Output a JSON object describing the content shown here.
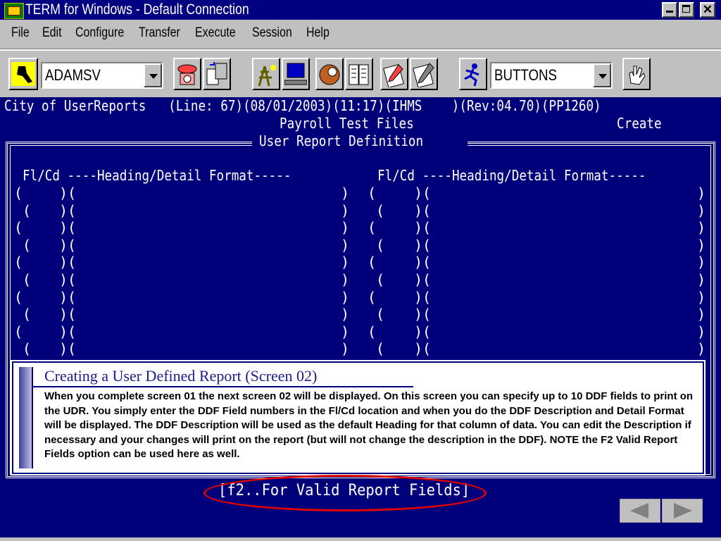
{
  "window": {
    "title": "TERM for Windows - Default Connection"
  },
  "menu": [
    {
      "label": "File"
    },
    {
      "label": "Edit"
    },
    {
      "label": "Configure"
    },
    {
      "label": "Transfer"
    },
    {
      "label": "Execute"
    },
    {
      "label": "Session"
    },
    {
      "label": "Help"
    }
  ],
  "toolbar": {
    "connection_combo": "ADAMSV",
    "buttons_combo": "BUTTONS"
  },
  "terminal": {
    "status_line": "City of UserReports   (Line: 67)(08/01/2003)(11:17)(IHMS    )(Rev:04.70)(PP1260)",
    "subtitle": "Payroll Test Files",
    "mode": "Create",
    "screen_title": "User Report Definition",
    "column_header_left": "Fl/Cd ----Heading/Detail Format-----",
    "column_header_right": "Fl/Cd ----Heading/Detail Format-----",
    "f2_hint": "[f2..For Valid Report Fields]"
  },
  "callout": {
    "title": "Creating a User Defined Report   (Screen 02)",
    "body": "When you complete screen 01 the next screen 02 will be displayed.  On this screen you can specify up to 10 DDF fields to print on the UDR.   You simply enter the DDF Field numbers in the Fl/Cd location and when you do the DDF Description and Detail Format will be displayed.   The DDF Description will be used as the default Heading for that column of data.  You can edit the Description if necessary and your changes will print on the report (but will not change the description in the DDF).   NOTE the F2 Valid Report Fields option can be used here as well."
  },
  "colors": {
    "terminal_bg": "#00007a",
    "title_bar": "#000080",
    "highlight_ellipse": "#e00000"
  }
}
